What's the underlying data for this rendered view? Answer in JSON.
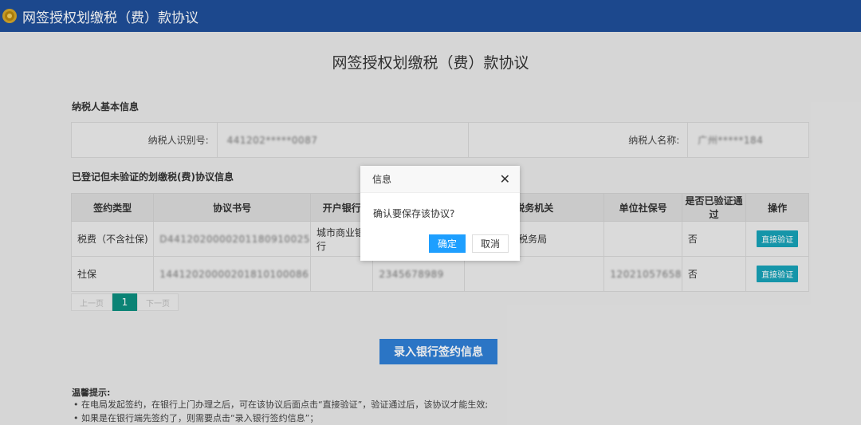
{
  "header": {
    "app_title": "网签授权划缴税（费）款协议",
    "logo_icon": "emblem-icon",
    "bar_color": "#1f4f9a"
  },
  "page": {
    "title": "网签授权划缴税（费）款协议"
  },
  "taxpayer_section": {
    "heading": "纳税人基本信息",
    "id_label": "纳税人识别号:",
    "id_value": "441202*****0087",
    "name_label": "纳税人名称:",
    "name_value": "广州*****184"
  },
  "agreements_section": {
    "heading": "已登记但未验证的划缴税(费)协议信息",
    "columns": [
      "签约类型",
      "协议书号",
      "开户银行",
      "",
      "税务机关",
      "单位社保号",
      "是否已验证通过",
      "操作"
    ],
    "rows": [
      {
        "type": "税费（不含社保)",
        "agreement_no": "D4412020000201180910025",
        "bank": "城市商业银行",
        "account": "",
        "tax_office": "庆市端州区税务局",
        "social_no": "",
        "verified": "否",
        "action": "直接验证"
      },
      {
        "type": "社保",
        "agreement_no": "14412020000201810100086",
        "bank": "",
        "account": "2345678989",
        "tax_office": "",
        "social_no": "12021057658",
        "verified": "否",
        "action": "直接验证"
      }
    ]
  },
  "pager": {
    "prev": "上一页",
    "current": "1",
    "next": "下一页"
  },
  "main_button": "录入银行签约信息",
  "tips": {
    "title": "温馨提示:",
    "items": [
      "• 在电局发起签约，在银行上门办理之后，可在该协议后面点击“直接验证”，验证通过后，该协议才能生效;",
      "• 如果是在银行端先签约了，则需要点击“录入银行签约信息”；"
    ]
  },
  "dialog": {
    "title": "信息",
    "message": "确认要保存该协议?",
    "ok": "确定",
    "cancel": "取消",
    "close_icon": "close-icon",
    "ok_color": "#1e9fff"
  }
}
